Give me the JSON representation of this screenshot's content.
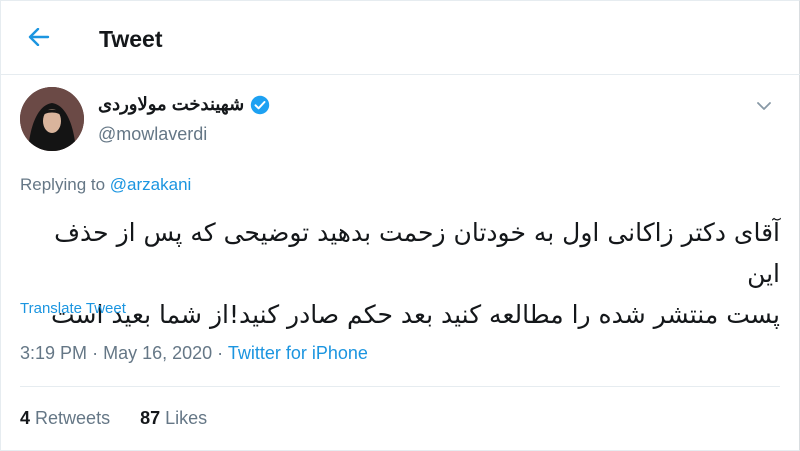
{
  "header": {
    "title": "Tweet"
  },
  "author": {
    "name": "شهیندخت مولاوردی",
    "handle": "@mowlaverdi"
  },
  "reply": {
    "prefix": "Replying to",
    "to": "@arzakani"
  },
  "tweet": {
    "line1": "آقای دکتر زاکانی اول به خودتان زحمت بدهید توضیحی که پس از حذف این",
    "line2": "پست منتشر شده را مطالعه کنید بعد حکم صادر کنید!از شما بعید است"
  },
  "translate_label": "Translate Tweet",
  "meta": {
    "time": "3:19 PM",
    "sep1": "·",
    "date": "May 16, 2020",
    "sep2": "·",
    "source": "Twitter for iPhone"
  },
  "stats": {
    "retweets_count": "4",
    "retweets_label": "Retweets",
    "likes_count": "87",
    "likes_label": "Likes"
  },
  "colors": {
    "accent": "#1b95e0",
    "secondary_text": "#657786",
    "primary_text": "#14171a",
    "border": "#e6ecf0"
  }
}
